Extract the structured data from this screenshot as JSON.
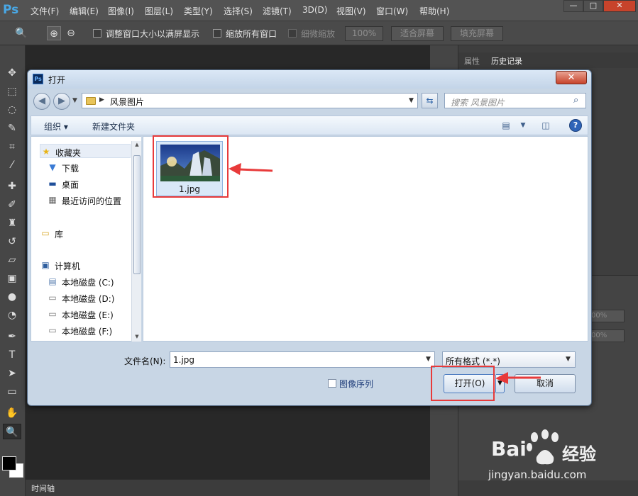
{
  "app": {
    "logo": "Ps",
    "menu": [
      "文件(F)",
      "编辑(E)",
      "图像(I)",
      "图层(L)",
      "类型(Y)",
      "选择(S)",
      "滤镜(T)",
      "3D(D)",
      "视图(V)",
      "窗口(W)",
      "帮助(H)"
    ],
    "window_controls": [
      "—",
      "□",
      "✕"
    ]
  },
  "options_bar": {
    "resize_windows_label": "调整窗口大小以满屏显示",
    "zoom_all_label": "缩放所有窗口",
    "scrubby_zoom_label": "细微缩放",
    "zoom_percent": "100%",
    "fit_screen": "适合屏幕",
    "fill_screen": "填充屏幕"
  },
  "right_panel": {
    "tabs": [
      "属性",
      "历史记录"
    ],
    "fields": [
      "00%",
      "00%"
    ]
  },
  "timeline": {
    "label": "时间轴"
  },
  "dialog": {
    "title": "打开",
    "close": "✕",
    "path": "风景图片",
    "search_placeholder": "搜索 风景图片",
    "toolbar": {
      "organize": "组织",
      "new_folder": "新建文件夹"
    },
    "nav": {
      "favorites": "收藏夹",
      "items": [
        "下载",
        "桌面",
        "最近访问的位置"
      ],
      "libraries": "库",
      "computer": "计算机",
      "drives": [
        "本地磁盘 (C:)",
        "本地磁盘 (D:)",
        "本地磁盘 (E:)",
        "本地磁盘 (F:)"
      ]
    },
    "file": {
      "name": "1.jpg"
    },
    "filename_label": "文件名(N):",
    "filename_value": "1.jpg",
    "filetype_value": "所有格式 (*.*)",
    "image_sequence_label": "图像序列",
    "open_button": "打开(O)",
    "cancel_button": "取消"
  },
  "watermark": {
    "brand_left": "Bai",
    "brand_right": "经验",
    "url": "jingyan.baidu.com"
  }
}
